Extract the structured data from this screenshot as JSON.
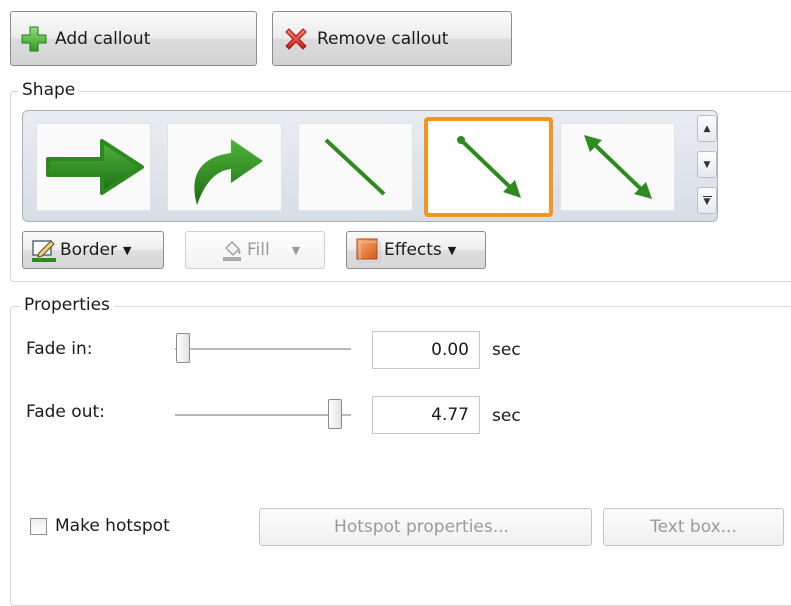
{
  "toolbar": {
    "add_callout": "Add callout",
    "remove_callout": "Remove callout"
  },
  "shape": {
    "group_label": "Shape",
    "tiles": [
      {
        "icon": "thick-arrow-right-icon",
        "selected": false
      },
      {
        "icon": "curved-arrow-right-icon",
        "selected": false
      },
      {
        "icon": "line-icon",
        "selected": false
      },
      {
        "icon": "line-arrow-icon",
        "selected": true
      },
      {
        "icon": "double-arrow-line-icon",
        "selected": false
      }
    ],
    "border_label": "Border",
    "fill_label": "Fill",
    "effects_label": "Effects",
    "colors": {
      "shape_green": "#2e8b1f",
      "selection_orange": "#f7931e"
    }
  },
  "properties": {
    "group_label": "Properties",
    "fade_in_label": "Fade in:",
    "fade_in_value": "0.00",
    "fade_in_unit": "sec",
    "fade_out_label": "Fade out:",
    "fade_out_value": "4.77",
    "fade_out_unit": "sec",
    "fade_in_slider_fraction": 0.0,
    "fade_out_slider_fraction": 0.9,
    "make_hotspot_label": "Make hotspot",
    "make_hotspot_checked": false,
    "hotspot_properties_label": "Hotspot properties...",
    "text_box_label": "Text box..."
  }
}
